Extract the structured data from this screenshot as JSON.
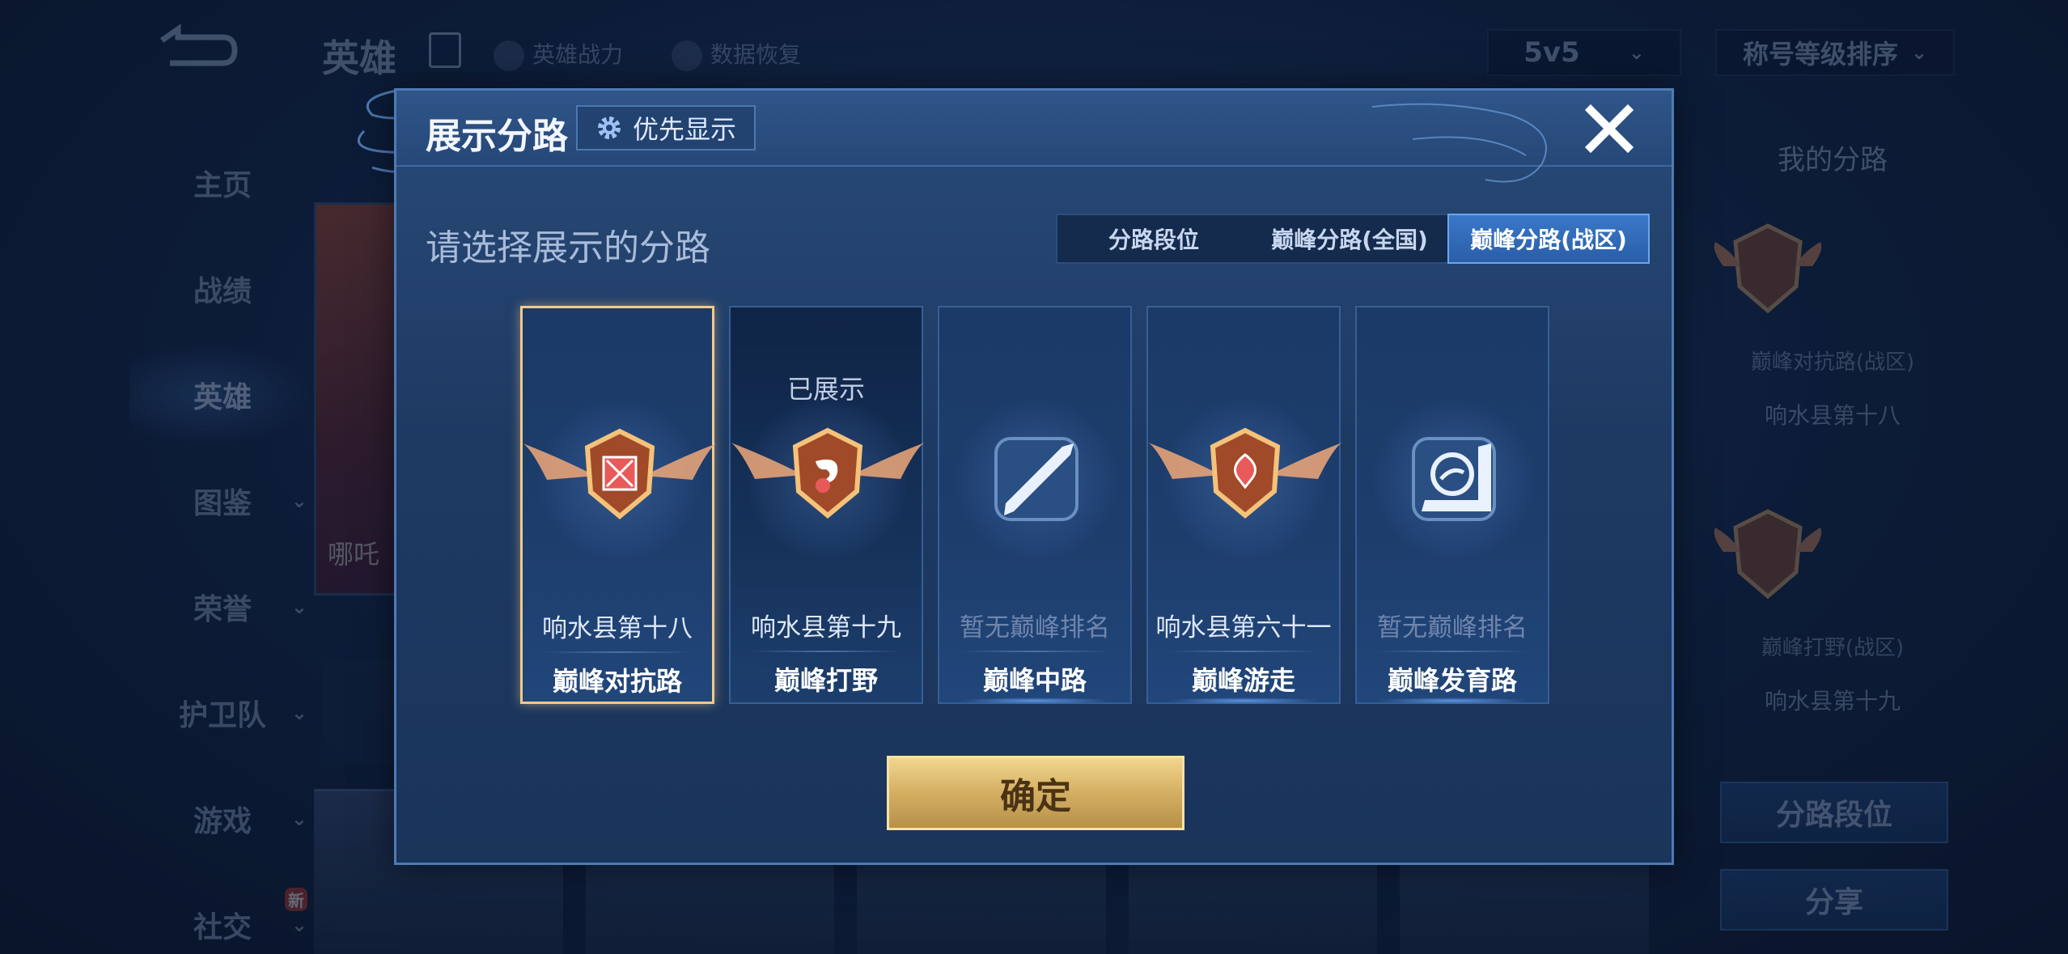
{
  "background": {
    "title": "英雄",
    "links": [
      "英雄战力",
      "数据恢复"
    ],
    "mode_select": "5v5",
    "sort_select": "称号等级排序",
    "nav": [
      "主页",
      "战绩",
      "英雄",
      "图鉴",
      "荣誉",
      "护卫队",
      "游戏",
      "社交"
    ],
    "nav_active_index": 2,
    "new_badge": "新",
    "hero_name": "哪吒",
    "right_panel": {
      "title": "我的分路",
      "items": [
        {
          "label": "巅峰对抗路(战区)",
          "value": "响水县第十八"
        },
        {
          "label": "巅峰打野(战区)",
          "value": "响水县第十九"
        }
      ],
      "buttons": [
        "分路段位",
        "分享"
      ]
    }
  },
  "modal": {
    "title": "展示分路",
    "priority_label": "优先显示",
    "subtitle": "请选择展示的分路",
    "tabs": [
      "分路段位",
      "巅峰分路(全国)",
      "巅峰分路(战区)"
    ],
    "active_tab": 2,
    "cards": [
      {
        "rank": "响水县第十八",
        "lane": "巅峰对抗路",
        "shown": "",
        "selected": true,
        "ranked": true,
        "icon": "top-lane-icon"
      },
      {
        "rank": "响水县第十九",
        "lane": "巅峰打野",
        "shown": "已展示",
        "selected": false,
        "ranked": true,
        "icon": "jungle-icon"
      },
      {
        "rank": "暂无巅峰排名",
        "lane": "巅峰中路",
        "shown": "",
        "selected": false,
        "ranked": false,
        "icon": "mid-lane-icon"
      },
      {
        "rank": "响水县第六十一",
        "lane": "巅峰游走",
        "shown": "",
        "selected": false,
        "ranked": true,
        "icon": "support-icon"
      },
      {
        "rank": "暂无巅峰排名",
        "lane": "巅峰发育路",
        "shown": "",
        "selected": false,
        "ranked": false,
        "icon": "bot-lane-icon"
      }
    ],
    "confirm_label": "确定"
  },
  "colors": {
    "accent_gold": "#d4af62",
    "active_tab": "#2a5ea8",
    "selected_border": "#f2c98a"
  }
}
